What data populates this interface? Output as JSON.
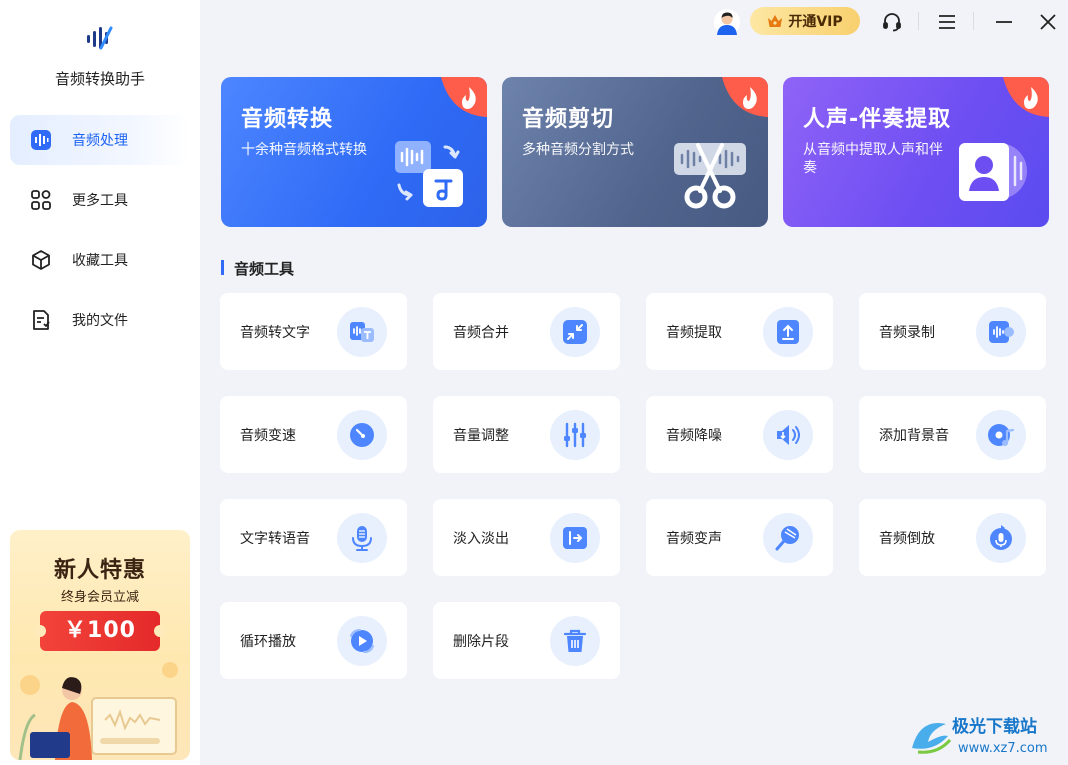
{
  "app": {
    "name": "音频转换助手"
  },
  "sidebar": {
    "items": [
      {
        "label": "音频处理",
        "icon": "audio-wave-icon",
        "active": true
      },
      {
        "label": "更多工具",
        "icon": "grid-icon",
        "active": false
      },
      {
        "label": "收藏工具",
        "icon": "cube-icon",
        "active": false
      },
      {
        "label": "我的文件",
        "icon": "document-icon",
        "active": false
      }
    ]
  },
  "promo": {
    "title": "新人特惠",
    "subtitle": "终身会员立减",
    "amount": "￥100"
  },
  "topbar": {
    "vip_label": "开通VIP",
    "icons": [
      "avatar",
      "crown-icon",
      "headset-icon",
      "menu-icon",
      "minimize-icon",
      "close-icon"
    ]
  },
  "features": [
    {
      "title": "音频转换",
      "desc": "十余种音频格式转换"
    },
    {
      "title": "音频剪切",
      "desc": "多种音频分割方式"
    },
    {
      "title": "人声-伴奏提取",
      "desc": "从音频中提取人声和伴奏"
    }
  ],
  "section": {
    "title": "音频工具"
  },
  "tools": [
    {
      "label": "音频转文字",
      "icon": "audio-to-text-icon"
    },
    {
      "label": "音频合并",
      "icon": "merge-icon"
    },
    {
      "label": "音频提取",
      "icon": "extract-icon"
    },
    {
      "label": "音频录制",
      "icon": "record-icon"
    },
    {
      "label": "音频变速",
      "icon": "speed-icon"
    },
    {
      "label": "音量调整",
      "icon": "volume-slider-icon"
    },
    {
      "label": "音频降噪",
      "icon": "denoise-icon"
    },
    {
      "label": "添加背景音",
      "icon": "background-music-icon"
    },
    {
      "label": "文字转语音",
      "icon": "microphone-icon"
    },
    {
      "label": "淡入淡出",
      "icon": "fade-icon"
    },
    {
      "label": "音频变声",
      "icon": "voice-change-icon"
    },
    {
      "label": "音频倒放",
      "icon": "reverse-icon"
    },
    {
      "label": "循环播放",
      "icon": "loop-icon"
    },
    {
      "label": "删除片段",
      "icon": "trash-icon"
    }
  ],
  "watermark": {
    "text": "极光下载站",
    "url_text": "www.xz7.com"
  },
  "colors": {
    "accent": "#2f6bf6",
    "icon_bg": "#e8f0fd",
    "sidebar_bg": "#ffffff",
    "content_bg": "#f1f3f8"
  }
}
